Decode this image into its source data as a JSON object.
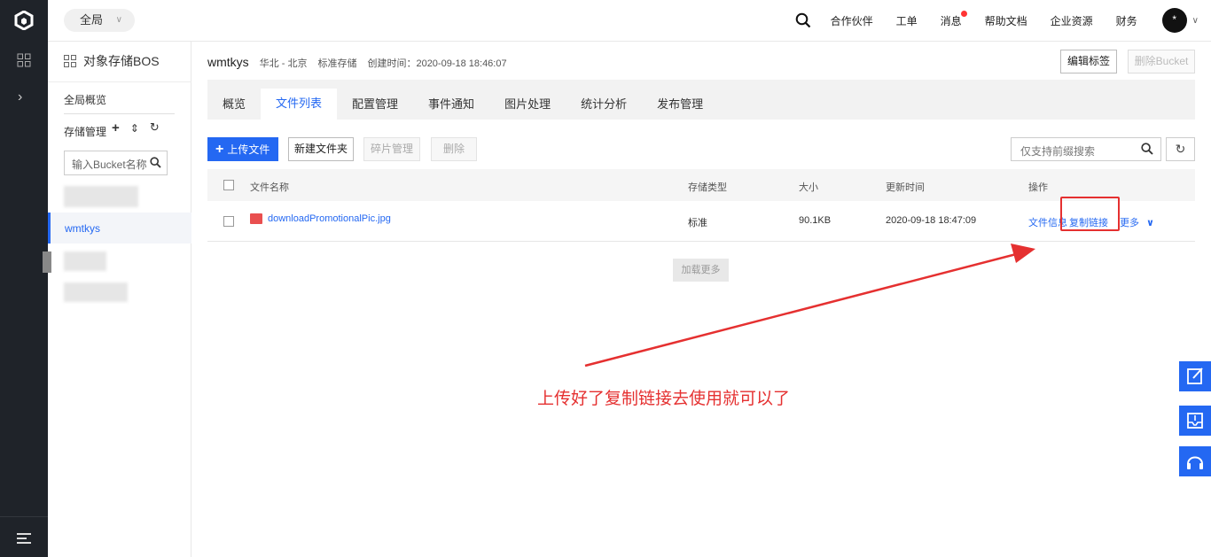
{
  "rail": {
    "logo": "logo-icon",
    "apps": "grid-icon",
    "expand": "›",
    "menu": "menu-icon"
  },
  "topbar": {
    "scope": "全局",
    "search_icon": "search-icon",
    "nav": [
      "合作伙伴",
      "工单",
      "消息",
      "帮助文档",
      "企业资源",
      "财务"
    ],
    "avatar": "*"
  },
  "sidebar": {
    "service": "对象存储BOS",
    "overview": "全局概览",
    "storage_mgmt": "存储管理",
    "mgmt_icons": [
      "+",
      "⇕",
      "↻"
    ],
    "bucket_search_placeholder": "输入Bucket名称",
    "active_bucket": "wmtkys"
  },
  "bucket": {
    "name": "wmtkys",
    "region": "华北 - 北京",
    "storage": "标准存储",
    "created": "创建时间：2020-09-18 18:46:07",
    "edit_tag": "编辑标签",
    "delete_bucket": "删除Bucket"
  },
  "tabs": [
    "概览",
    "文件列表",
    "配置管理",
    "事件通知",
    "图片处理",
    "统计分析",
    "发布管理"
  ],
  "toolbar": {
    "upload": "上传文件",
    "new_folder": "新建文件夹",
    "fragments": "碎片管理",
    "delete": "删除",
    "search_placeholder": "仅支持前缀搜索"
  },
  "table": {
    "headers": [
      "文件名称",
      "存储类型",
      "大小",
      "更新时间",
      "操作"
    ],
    "rows": [
      {
        "name": "downloadPromotionalPic.jpg",
        "type": "标准",
        "size": "90.1KB",
        "updated": "2020-09-18 18:47:09",
        "ops": [
          "文件信息",
          "复制链接",
          "更多"
        ]
      }
    ],
    "load_more": "加载更多"
  },
  "annotation": {
    "caption": "上传好了复制链接去使用就可以了",
    "color": "#e53030"
  },
  "float_buttons": [
    "edit-icon",
    "inbox-icon",
    "headset-icon"
  ],
  "colors": {
    "accent": "#2468f2",
    "rail": "#1f2329"
  }
}
